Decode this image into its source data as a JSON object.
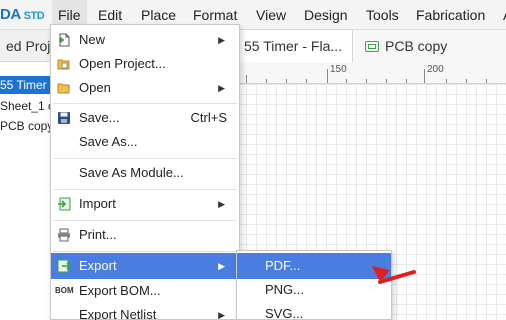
{
  "app": {
    "logo_main": "DA",
    "logo_sub": "STD"
  },
  "menubar": {
    "items": [
      "File",
      "Edit",
      "Place",
      "Format",
      "View",
      "Design",
      "Tools",
      "Fabrication",
      "A"
    ]
  },
  "tabs": {
    "project_label": "ed Projec",
    "schematic_label": "55 Timer - Fla...",
    "pcb_label": "PCB copy"
  },
  "tree": {
    "items": [
      "55 Timer -",
      "Sheet_1 c",
      "PCB copy"
    ]
  },
  "ruler": {
    "labels": [
      "150",
      "200"
    ]
  },
  "file_menu": {
    "items": [
      {
        "label": "New",
        "submenu": true,
        "icon": "new-icon"
      },
      {
        "label": "Open Project...",
        "icon": "open-project-icon"
      },
      {
        "label": "Open",
        "submenu": true,
        "icon": "open-folder-icon"
      },
      {
        "label": "Save...",
        "shortcut": "Ctrl+S",
        "icon": "save-icon"
      },
      {
        "label": "Save As..."
      },
      {
        "label": "Save As Module..."
      },
      {
        "label": "Import",
        "submenu": true,
        "icon": "import-icon"
      },
      {
        "label": "Print...",
        "icon": "print-icon"
      },
      {
        "label": "Export",
        "submenu": true,
        "icon": "export-icon"
      },
      {
        "label": "Export BOM...",
        "icon_text": "BOM"
      },
      {
        "label": "Export Netlist",
        "submenu": true
      }
    ]
  },
  "export_submenu": {
    "items": [
      "PDF...",
      "PNG...",
      "SVG..."
    ]
  },
  "colors": {
    "highlight": "#4a7de0",
    "accent_red": "#e02020",
    "selection": "#1e73d2"
  }
}
